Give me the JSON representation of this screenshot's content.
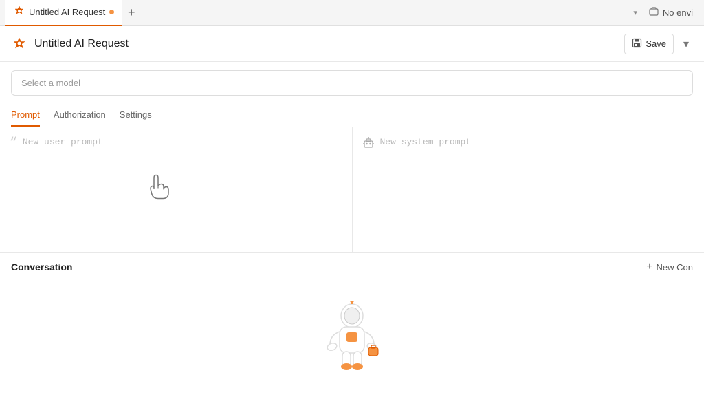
{
  "tab_bar": {
    "active_tab_label": "Untitled AI Request",
    "tab_dot_visible": true,
    "add_tab_label": "+",
    "chevron_label": "▾",
    "no_env_label": "No envi"
  },
  "header": {
    "title": "Untitled AI Request",
    "save_label": "Save",
    "chevron_label": "▾"
  },
  "model_selector": {
    "placeholder": "Select a model"
  },
  "sub_tabs": [
    {
      "label": "Prompt",
      "active": true
    },
    {
      "label": "Authorization",
      "active": false
    },
    {
      "label": "Settings",
      "active": false
    }
  ],
  "prompt": {
    "user_placeholder": "New user prompt",
    "system_placeholder": "New system prompt"
  },
  "conversation": {
    "title": "Conversation",
    "new_button_label": "New Con"
  }
}
